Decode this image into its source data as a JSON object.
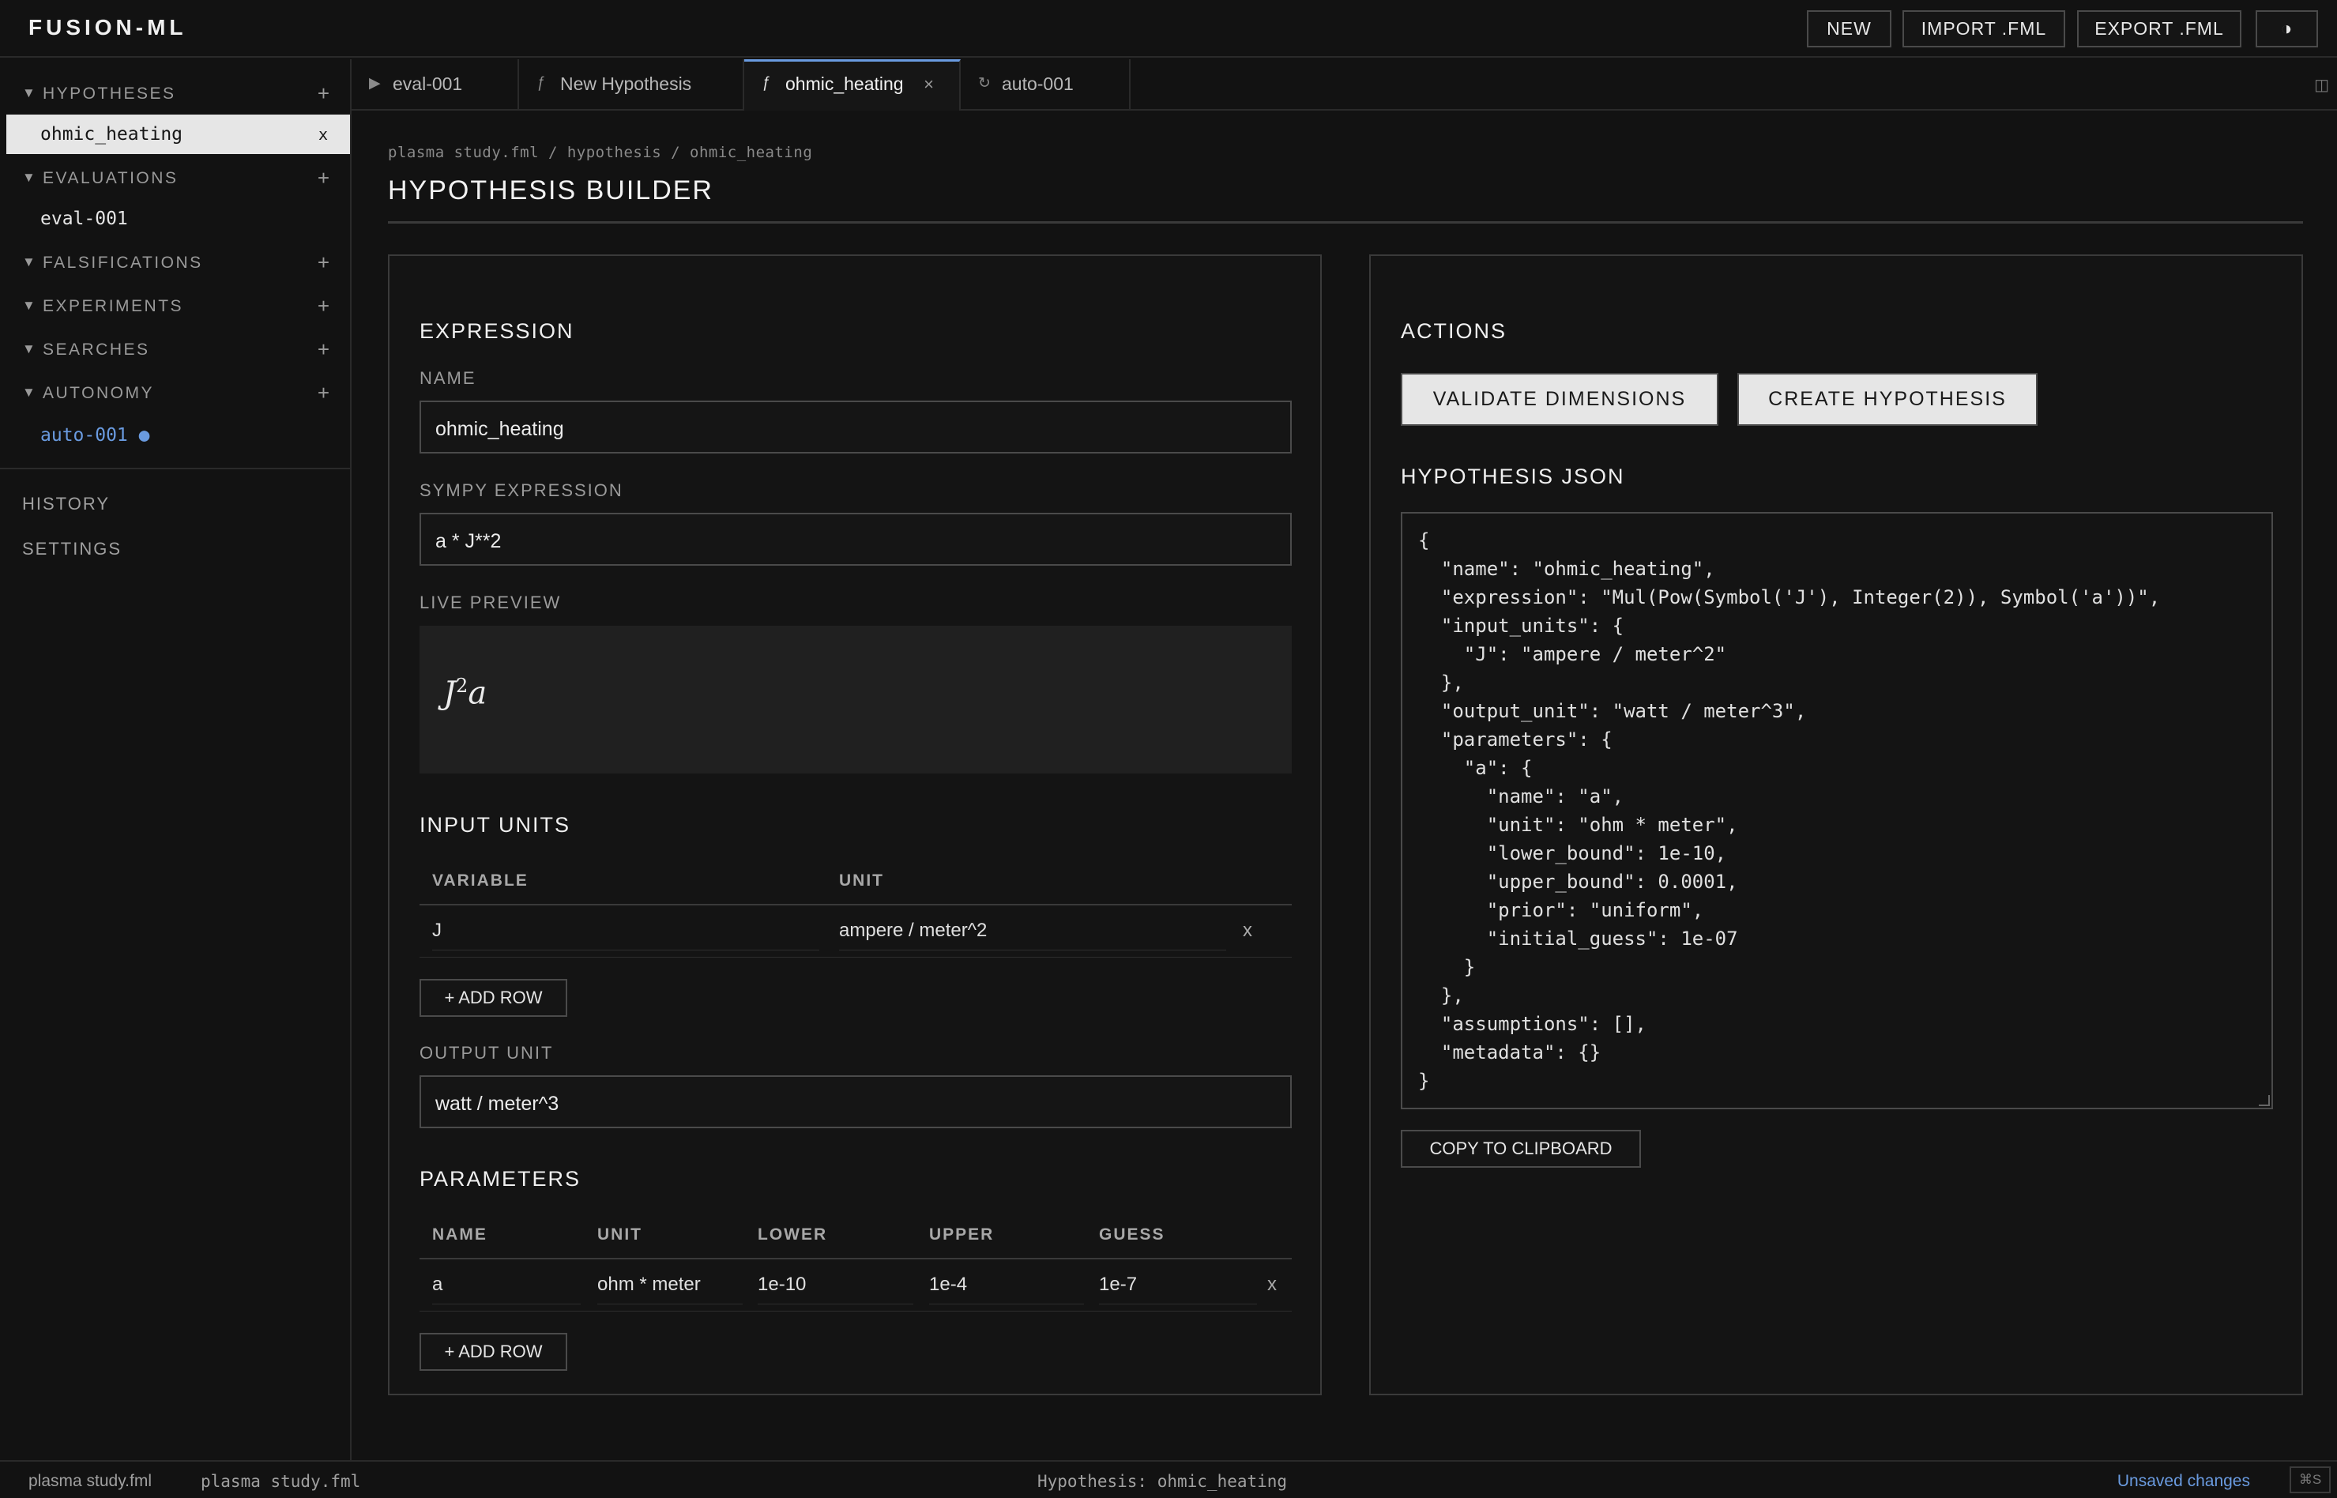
{
  "app": {
    "brand": "FUSION-ML"
  },
  "toolbar": {
    "new_label": "NEW",
    "import_label": "IMPORT .FML",
    "export_label": "EXPORT .FML",
    "theme_icon": "◑"
  },
  "sidebar": {
    "sections": [
      {
        "label": "HYPOTHESES",
        "items": [
          "ohmic_heating"
        ]
      },
      {
        "label": "EVALUATIONS",
        "items": [
          "eval-001"
        ]
      },
      {
        "label": "FALSIFICATIONS",
        "items": []
      },
      {
        "label": "EXPERIMENTS",
        "items": []
      },
      {
        "label": "SEARCHES",
        "items": []
      },
      {
        "label": "AUTONOMY",
        "items": [
          "auto-001 ●"
        ]
      }
    ],
    "selected_item_close": "x",
    "history_label": "HISTORY",
    "settings_label": "SETTINGS"
  },
  "tabs": [
    {
      "icon": "▶",
      "label": "eval-001",
      "active": false
    },
    {
      "icon": "ƒ",
      "label": "New Hypothesis",
      "active": false
    },
    {
      "icon": "ƒ",
      "label": "ohmic_heating",
      "active": true,
      "close": "×"
    },
    {
      "icon": "↻",
      "label": "auto-001",
      "active": false
    }
  ],
  "main": {
    "breadcrumb": "plasma study.fml / hypothesis / ohmic_heating",
    "title": "HYPOTHESIS BUILDER",
    "expression": {
      "heading": "EXPRESSION",
      "name_label": "NAME",
      "name_value": "ohmic_heating",
      "sympy_label": "SYMPY EXPRESSION",
      "sympy_value": "a * J**2",
      "preview_label": "LIVE PREVIEW",
      "preview_base": "J",
      "preview_exp": "2",
      "preview_tail": "a",
      "input_units_heading": "INPUT UNITS",
      "input_units_columns": [
        "VARIABLE",
        "UNIT"
      ],
      "input_units_rows": [
        {
          "variable": "J",
          "unit": "ampere / meter^2",
          "remove": "x"
        }
      ],
      "add_row_label": "+ ADD ROW",
      "output_unit_label": "OUTPUT UNIT",
      "output_unit_value": "watt / meter^3",
      "parameters_heading": "PARAMETERS",
      "parameters_columns": [
        "NAME",
        "UNIT",
        "LOWER",
        "UPPER",
        "GUESS"
      ],
      "parameters_rows": [
        {
          "name": "a",
          "unit": "ohm * meter",
          "lower": "1e-10",
          "upper": "1e-4",
          "guess": "1e-7",
          "remove": "x"
        }
      ]
    },
    "actions": {
      "heading": "ACTIONS",
      "validate_label": "VALIDATE DIMENSIONS",
      "create_label": "CREATE HYPOTHESIS",
      "json_heading": "HYPOTHESIS JSON",
      "json_text": "{\n  \"name\": \"ohmic_heating\",\n  \"expression\": \"Mul(Pow(Symbol('J'), Integer(2)), Symbol('a'))\",\n  \"input_units\": {\n    \"J\": \"ampere / meter^2\"\n  },\n  \"output_unit\": \"watt / meter^3\",\n  \"parameters\": {\n    \"a\": {\n      \"name\": \"a\",\n      \"unit\": \"ohm * meter\",\n      \"lower_bound\": 1e-10,\n      \"upper_bound\": 0.0001,\n      \"prior\": \"uniform\",\n      \"initial_guess\": 1e-07\n    }\n  },\n  \"assumptions\": [],\n  \"metadata\": {}\n}",
      "copy_label": "COPY TO CLIPBOARD"
    }
  },
  "status": {
    "file1": "plasma study.fml",
    "file2": "plasma study.fml",
    "center": "Hypothesis: ohmic_heating",
    "unsaved": "Unsaved changes",
    "shortcut": "⌘S"
  },
  "colors": {
    "accent": "#6a9be0",
    "selected_bg": "#e6e6e6",
    "background": "#121212"
  }
}
